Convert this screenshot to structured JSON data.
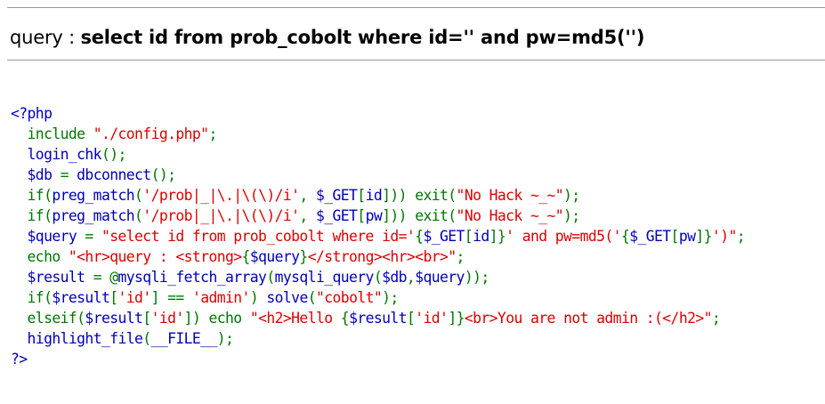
{
  "header": {
    "label": "query : ",
    "query": "select id from prob_cobolt where id='' and pw=md5('')"
  },
  "colors": {
    "default": "#0000BB",
    "keyword": "#007700",
    "string": "#DD0000",
    "rule": "#9a9a9a"
  },
  "code_lines": [
    [
      {
        "t": "<?php",
        "c": "blue"
      }
    ],
    [
      {
        "t": "  include ",
        "c": "green"
      },
      {
        "t": "\"./config.php\"",
        "c": "red"
      },
      {
        "t": ";",
        "c": "green"
      }
    ],
    [
      {
        "t": "  login_chk",
        "c": "blue"
      },
      {
        "t": "();",
        "c": "green"
      }
    ],
    [
      {
        "t": "  $db ",
        "c": "blue"
      },
      {
        "t": "= ",
        "c": "green"
      },
      {
        "t": "dbconnect",
        "c": "blue"
      },
      {
        "t": "();",
        "c": "green"
      }
    ],
    [
      {
        "t": "  if(",
        "c": "green"
      },
      {
        "t": "preg_match",
        "c": "blue"
      },
      {
        "t": "(",
        "c": "green"
      },
      {
        "t": "'/prob|_|\\.|\\(\\)/i'",
        "c": "red"
      },
      {
        "t": ", ",
        "c": "green"
      },
      {
        "t": "$_GET",
        "c": "blue"
      },
      {
        "t": "[",
        "c": "green"
      },
      {
        "t": "id",
        "c": "blue"
      },
      {
        "t": "])) exit(",
        "c": "green"
      },
      {
        "t": "\"No Hack ~_~\"",
        "c": "red"
      },
      {
        "t": ");",
        "c": "green"
      }
    ],
    [
      {
        "t": "  if(",
        "c": "green"
      },
      {
        "t": "preg_match",
        "c": "blue"
      },
      {
        "t": "(",
        "c": "green"
      },
      {
        "t": "'/prob|_|\\.|\\(\\)/i'",
        "c": "red"
      },
      {
        "t": ", ",
        "c": "green"
      },
      {
        "t": "$_GET",
        "c": "blue"
      },
      {
        "t": "[",
        "c": "green"
      },
      {
        "t": "pw",
        "c": "blue"
      },
      {
        "t": "])) exit(",
        "c": "green"
      },
      {
        "t": "\"No Hack ~_~\"",
        "c": "red"
      },
      {
        "t": ");",
        "c": "green"
      }
    ],
    [
      {
        "t": "  $query ",
        "c": "blue"
      },
      {
        "t": "= ",
        "c": "green"
      },
      {
        "t": "\"select id from prob_cobolt where id='",
        "c": "red"
      },
      {
        "t": "{",
        "c": "green"
      },
      {
        "t": "$_GET",
        "c": "blue"
      },
      {
        "t": "[",
        "c": "green"
      },
      {
        "t": "id",
        "c": "blue"
      },
      {
        "t": "]}",
        "c": "green"
      },
      {
        "t": "' and pw=md5('",
        "c": "red"
      },
      {
        "t": "{",
        "c": "green"
      },
      {
        "t": "$_GET",
        "c": "blue"
      },
      {
        "t": "[",
        "c": "green"
      },
      {
        "t": "pw",
        "c": "blue"
      },
      {
        "t": "]}",
        "c": "green"
      },
      {
        "t": "')\"",
        "c": "red"
      },
      {
        "t": ";",
        "c": "green"
      }
    ],
    [
      {
        "t": "  echo ",
        "c": "green"
      },
      {
        "t": "\"<hr>query : <strong>",
        "c": "red"
      },
      {
        "t": "{",
        "c": "green"
      },
      {
        "t": "$query",
        "c": "blue"
      },
      {
        "t": "}",
        "c": "green"
      },
      {
        "t": "</strong><hr><br>\"",
        "c": "red"
      },
      {
        "t": ";",
        "c": "green"
      }
    ],
    [
      {
        "t": "  $result ",
        "c": "blue"
      },
      {
        "t": "= @",
        "c": "green"
      },
      {
        "t": "mysqli_fetch_array",
        "c": "blue"
      },
      {
        "t": "(",
        "c": "green"
      },
      {
        "t": "mysqli_query",
        "c": "blue"
      },
      {
        "t": "(",
        "c": "green"
      },
      {
        "t": "$db",
        "c": "blue"
      },
      {
        "t": ",",
        "c": "green"
      },
      {
        "t": "$query",
        "c": "blue"
      },
      {
        "t": "));",
        "c": "green"
      }
    ],
    [
      {
        "t": "  if(",
        "c": "green"
      },
      {
        "t": "$result",
        "c": "blue"
      },
      {
        "t": "[",
        "c": "green"
      },
      {
        "t": "'id'",
        "c": "red"
      },
      {
        "t": "] == ",
        "c": "green"
      },
      {
        "t": "'admin'",
        "c": "red"
      },
      {
        "t": ") ",
        "c": "green"
      },
      {
        "t": "solve",
        "c": "blue"
      },
      {
        "t": "(",
        "c": "green"
      },
      {
        "t": "\"cobolt\"",
        "c": "red"
      },
      {
        "t": ");",
        "c": "green"
      }
    ],
    [
      {
        "t": "  elseif(",
        "c": "green"
      },
      {
        "t": "$result",
        "c": "blue"
      },
      {
        "t": "[",
        "c": "green"
      },
      {
        "t": "'id'",
        "c": "red"
      },
      {
        "t": "]) echo ",
        "c": "green"
      },
      {
        "t": "\"<h2>Hello ",
        "c": "red"
      },
      {
        "t": "{",
        "c": "green"
      },
      {
        "t": "$result",
        "c": "blue"
      },
      {
        "t": "[",
        "c": "green"
      },
      {
        "t": "'id'",
        "c": "red"
      },
      {
        "t": "]}",
        "c": "green"
      },
      {
        "t": "<br>You are not admin :(</h2>\"",
        "c": "red"
      },
      {
        "t": ";",
        "c": "green"
      }
    ],
    [
      {
        "t": "  highlight_file",
        "c": "blue"
      },
      {
        "t": "(",
        "c": "green"
      },
      {
        "t": "__FILE__",
        "c": "blue"
      },
      {
        "t": ");",
        "c": "green"
      }
    ],
    [
      {
        "t": "?>",
        "c": "blue"
      }
    ]
  ]
}
